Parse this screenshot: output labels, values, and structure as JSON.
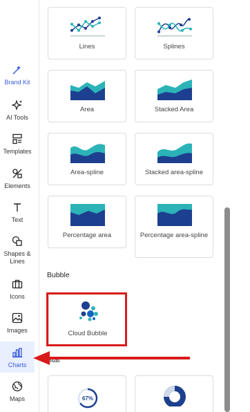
{
  "sidebar": {
    "items": [
      {
        "label": "Brand Kit",
        "icon": "magic-wand-icon"
      },
      {
        "label": "AI Tools",
        "icon": "sparkle-icon"
      },
      {
        "label": "Templates",
        "icon": "templates-icon"
      },
      {
        "label": "Elements",
        "icon": "elements-icon"
      },
      {
        "label": "Text",
        "icon": "text-icon"
      },
      {
        "label": "Shapes &\nLines",
        "icon": "shapes-icon"
      },
      {
        "label": "Icons",
        "icon": "briefcase-icon"
      },
      {
        "label": "Images",
        "icon": "image-icon"
      },
      {
        "label": "Charts",
        "icon": "bar-chart-icon"
      },
      {
        "label": "Maps",
        "icon": "globe-icon"
      }
    ],
    "active": "Charts"
  },
  "charts": {
    "line_cards": [
      {
        "label": "Lines"
      },
      {
        "label": "Splines"
      }
    ],
    "area_cards": [
      {
        "label": "Area"
      },
      {
        "label": "Stacked Area"
      },
      {
        "label": "Area-spline"
      },
      {
        "label": "Stacked area-spline"
      },
      {
        "label": "Percentage area"
      },
      {
        "label": "Percentage area-spline"
      }
    ],
    "bubble_title": "Bubble",
    "bubble_cards": [
      {
        "label": "Cloud Bubble"
      }
    ],
    "stat_title": "Stat",
    "stat_cards": [
      {
        "label": "67%"
      }
    ]
  },
  "colors": {
    "accent": "#3b5bdb",
    "annotation": "#d91a1a",
    "chart_dark": "#1d3f8f",
    "chart_teal": "#2bb3b8"
  }
}
